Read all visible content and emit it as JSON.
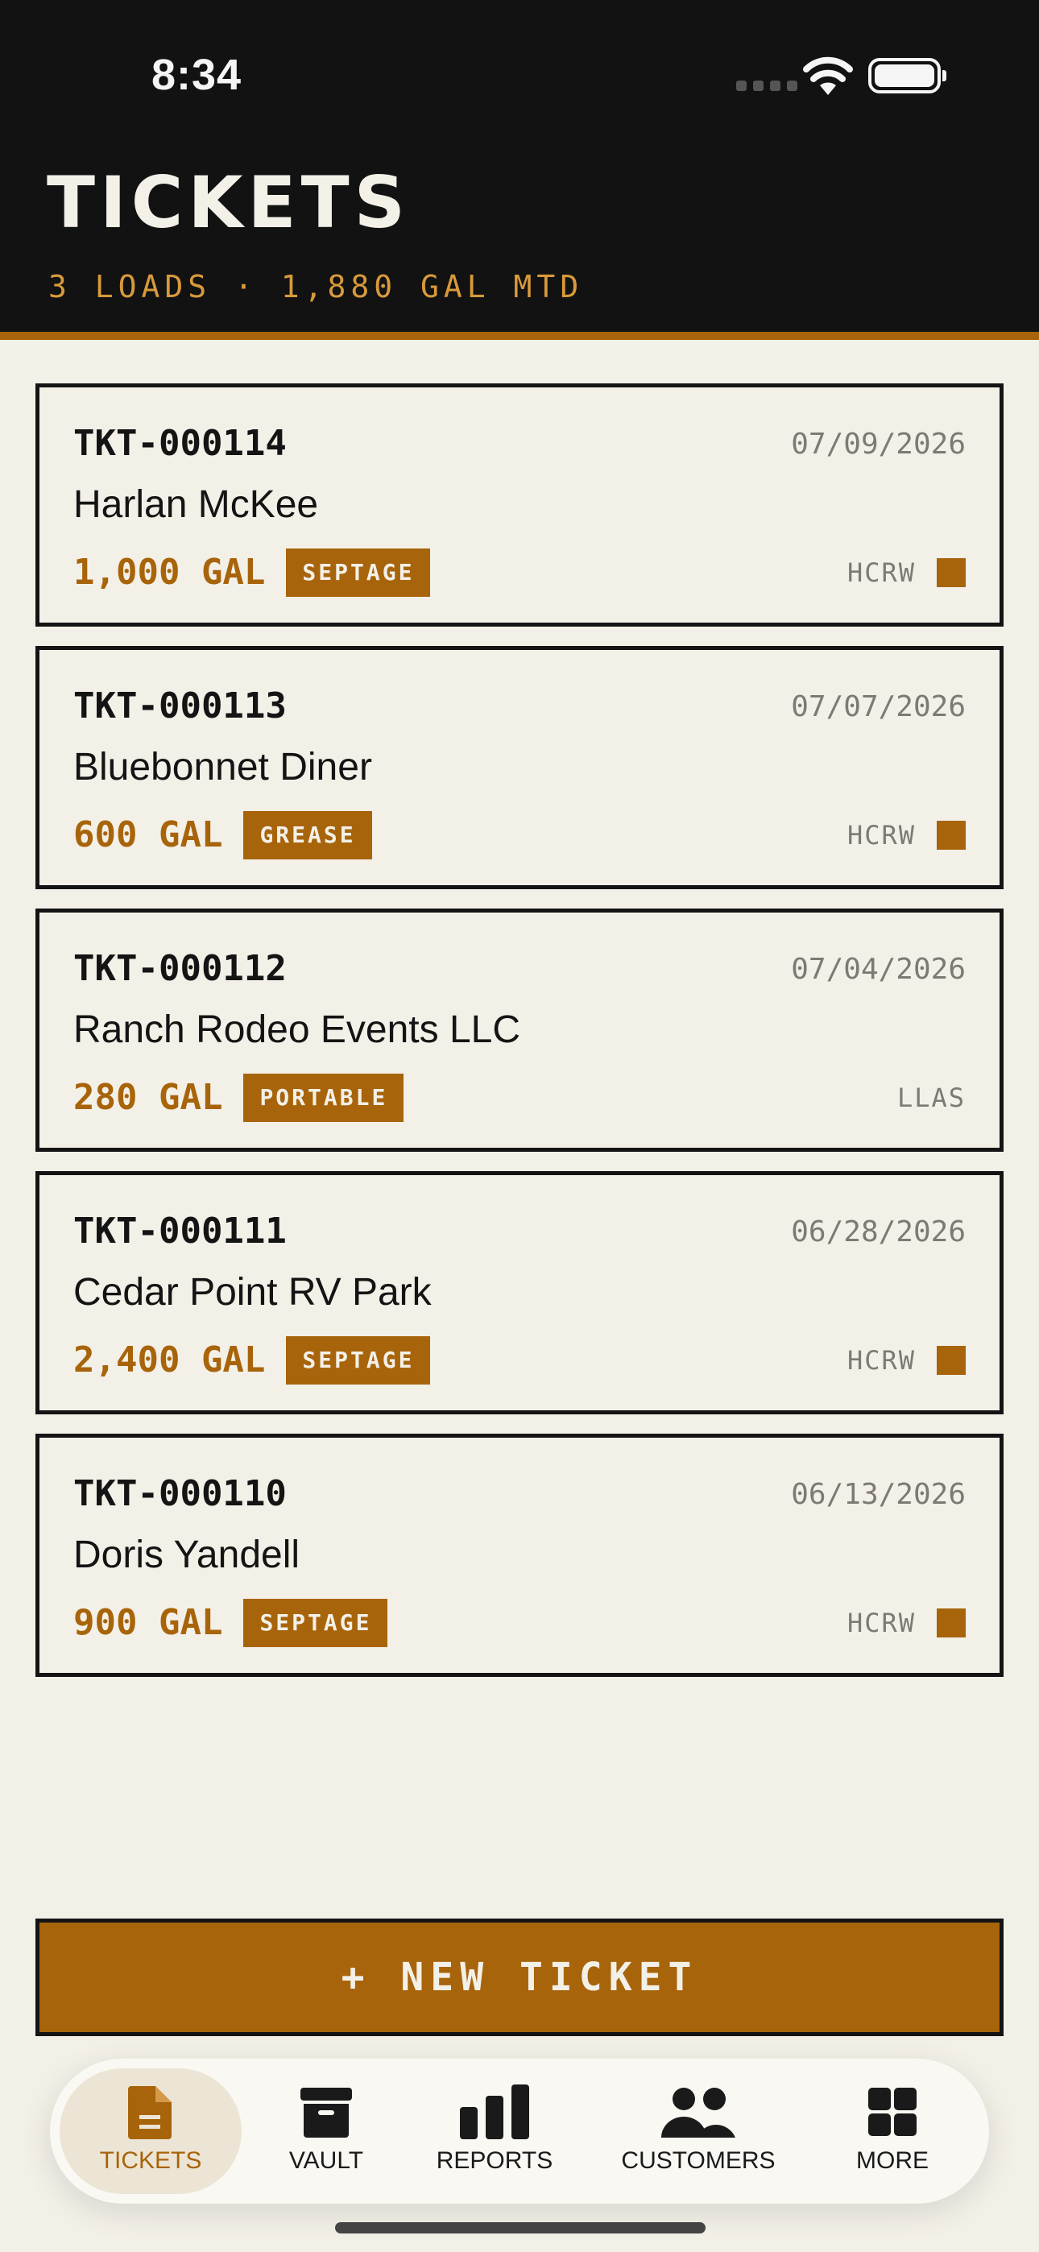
{
  "status": {
    "time": "8:34"
  },
  "header": {
    "title": "TICKETS",
    "subtitle": "3 LOADS · 1,880 GAL MTD"
  },
  "tickets": [
    {
      "id": "TKT-000114",
      "date": "07/09/2026",
      "customer": "Harlan McKee",
      "gallons": "1,000 GAL",
      "type": "SEPTAGE",
      "facility": "HCRW",
      "marker": true
    },
    {
      "id": "TKT-000113",
      "date": "07/07/2026",
      "customer": "Bluebonnet Diner",
      "gallons": "600 GAL",
      "type": "GREASE",
      "facility": "HCRW",
      "marker": true
    },
    {
      "id": "TKT-000112",
      "date": "07/04/2026",
      "customer": "Ranch Rodeo Events LLC",
      "gallons": "280 GAL",
      "type": "PORTABLE",
      "facility": "LLAS",
      "marker": false
    },
    {
      "id": "TKT-000111",
      "date": "06/28/2026",
      "customer": "Cedar Point RV Park",
      "gallons": "2,400 GAL",
      "type": "SEPTAGE",
      "facility": "HCRW",
      "marker": true
    },
    {
      "id": "TKT-000110",
      "date": "06/13/2026",
      "customer": "Doris Yandell",
      "gallons": "900 GAL",
      "type": "SEPTAGE",
      "facility": "HCRW",
      "marker": true
    }
  ],
  "actions": {
    "new_ticket": "+ NEW TICKET"
  },
  "tabs": [
    {
      "label": "TICKETS",
      "icon": "document-icon",
      "active": true
    },
    {
      "label": "VAULT",
      "icon": "archive-box-icon",
      "active": false
    },
    {
      "label": "REPORTS",
      "icon": "bar-chart-icon",
      "active": false
    },
    {
      "label": "CUSTOMERS",
      "icon": "people-icon",
      "active": false
    },
    {
      "label": "MORE",
      "icon": "grid-icon",
      "active": false
    }
  ],
  "colors": {
    "accent": "#a8640a",
    "header_bg": "#121212",
    "page_bg": "#f3f0e8"
  }
}
